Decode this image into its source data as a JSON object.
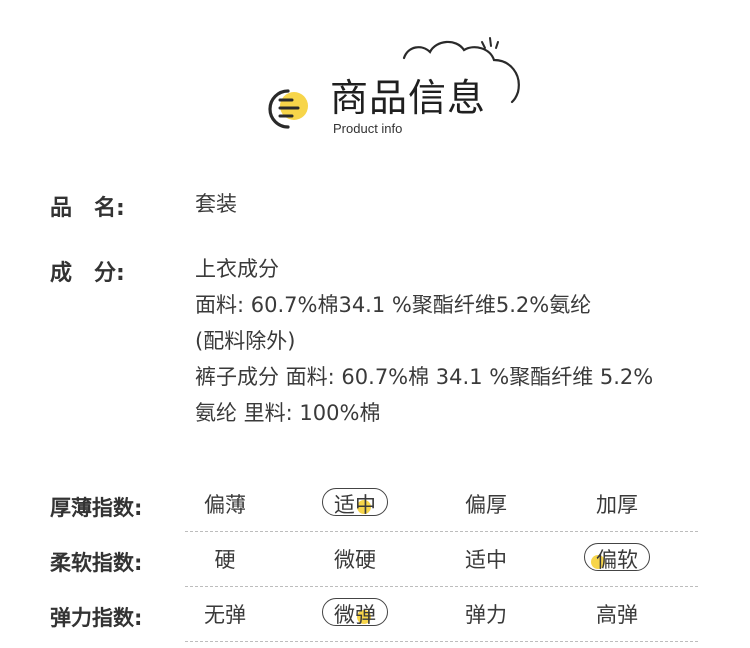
{
  "header": {
    "title_cn": "商品信息",
    "title_en": "Product info",
    "accent_color": "#f7d54a"
  },
  "fields": [
    {
      "label": "品　名:",
      "lines": [
        "套装"
      ]
    },
    {
      "label": "成　分:",
      "lines": [
        "上衣成分",
        "面料: 60.7%棉34.1 %聚酯纤维5.2%氨纶",
        "(配料除外)",
        "裤子成分 面料: 60.7%棉 34.1 %聚酯纤维 5.2%",
        "氨纶 里料: 100%棉"
      ]
    }
  ],
  "indices": [
    {
      "label": "厚薄指数:",
      "options": [
        "偏薄",
        "适中",
        "偏厚",
        "加厚"
      ],
      "selected": 1
    },
    {
      "label": "柔软指数:",
      "options": [
        "硬",
        "微硬",
        "适中",
        "偏软"
      ],
      "selected": 3
    },
    {
      "label": "弹力指数:",
      "options": [
        "无弹",
        "微弹",
        "弹力",
        "高弹"
      ],
      "selected": 1
    }
  ]
}
